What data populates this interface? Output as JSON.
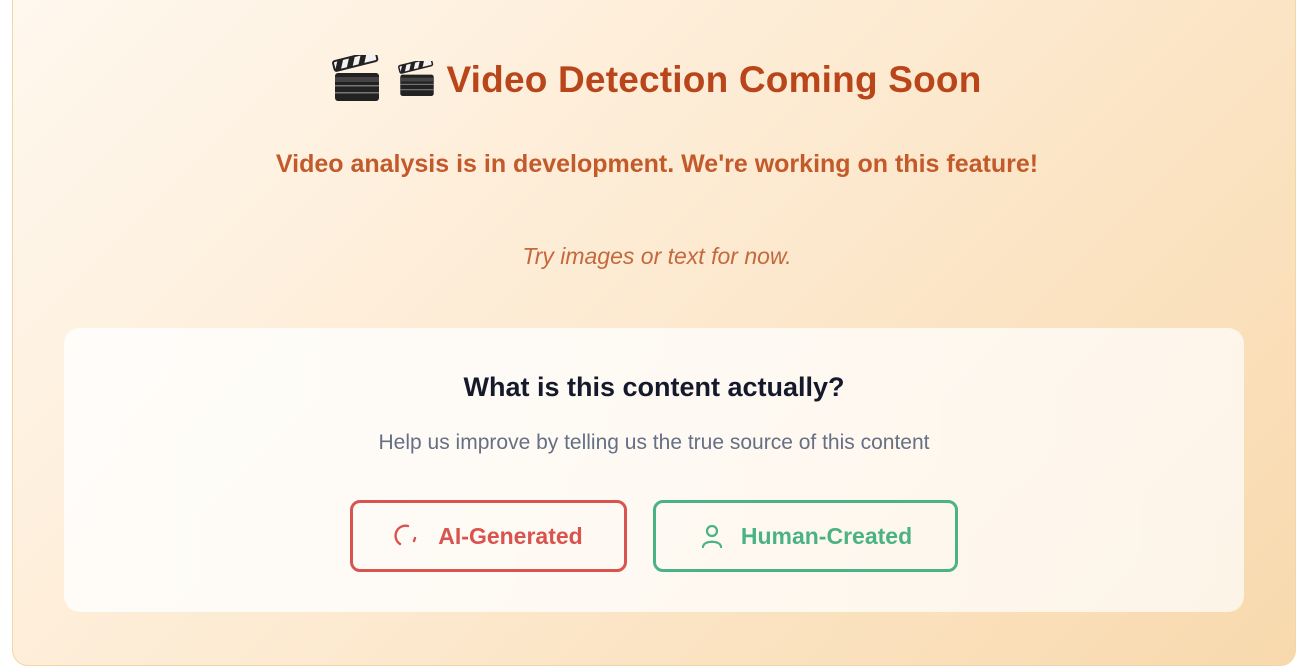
{
  "header": {
    "emoji_large": "🎬",
    "emoji_small": "🎬",
    "title": "Video Detection Coming Soon",
    "subtitle": "Video analysis is in development. We're working on this feature!",
    "hint": "Try images or text for now."
  },
  "feedback": {
    "title": "What is this content actually?",
    "subtitle": "Help us improve by telling us the true source of this content",
    "buttons": {
      "ai": {
        "label": "AI-Generated",
        "icon": "loading-spinner-icon",
        "color": "#d9534f"
      },
      "human": {
        "label": "Human-Created",
        "icon": "user-icon",
        "color": "#4bb383"
      }
    }
  },
  "colors": {
    "title": "#b9451b",
    "subtitle": "#c25a2b",
    "hint": "#c4683d",
    "feedback_title": "#141a2c",
    "feedback_subtitle": "#667085"
  }
}
